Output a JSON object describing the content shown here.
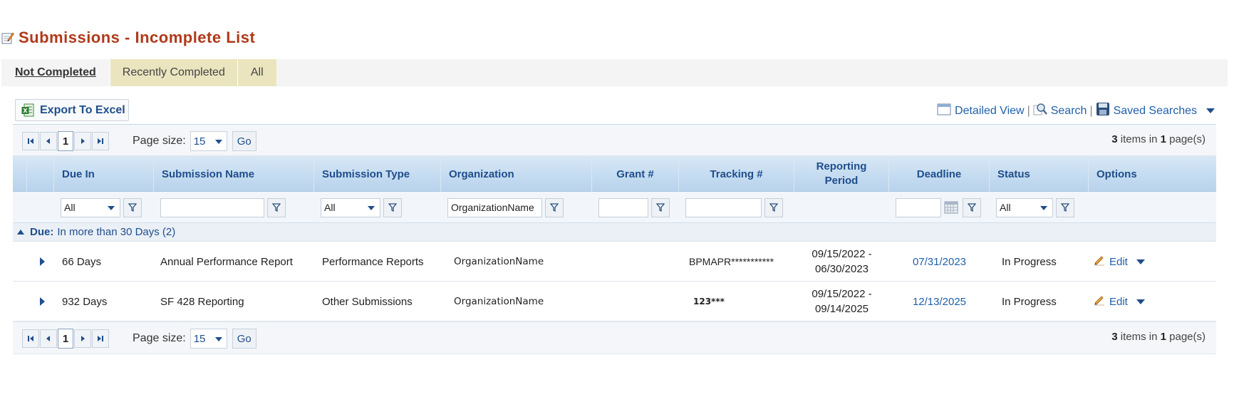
{
  "page": {
    "title": "Submissions - Incomplete List"
  },
  "tabs": [
    {
      "label": "Not Completed",
      "active": true
    },
    {
      "label": "Recently Completed",
      "active": false
    },
    {
      "label": "All",
      "active": false
    }
  ],
  "toolbar": {
    "export_label": "Export To Excel",
    "detailed_view_label": "Detailed View",
    "search_label": "Search",
    "saved_searches_label": "Saved Searches",
    "separator": "|"
  },
  "pager": {
    "current_page": "1",
    "page_size_label": "Page size:",
    "page_size_value": "15",
    "go_label": "Go",
    "items_count": "3",
    "items_text": "items in",
    "pages_count": "1",
    "pages_text": "page(s)"
  },
  "columns": {
    "due_in": "Due In",
    "submission_name": "Submission Name",
    "submission_type": "Submission Type",
    "organization": "Organization",
    "grant": "Grant #",
    "tracking": "Tracking #",
    "reporting_period_1": "Reporting",
    "reporting_period_2": "Period",
    "deadline": "Deadline",
    "status": "Status",
    "options": "Options"
  },
  "filters": {
    "due_in": "All",
    "submission_name": "",
    "submission_type": "All",
    "organization": "OrganizationName",
    "grant": "",
    "tracking": "",
    "deadline": "",
    "status": "All"
  },
  "group": {
    "label": "Due:",
    "value": "In more than 30 Days (2)"
  },
  "rows": [
    {
      "due_in": "66 Days",
      "submission_name": "Annual Performance Report",
      "submission_type": "Performance Reports",
      "organization": "OrganizationName",
      "grant": "",
      "tracking": "BPMAPR***********",
      "period_start": "09/15/2022 -",
      "period_end": "06/30/2023",
      "deadline": "07/31/2023",
      "status": "In Progress",
      "action": "Edit"
    },
    {
      "due_in": "932 Days",
      "submission_name": "SF 428 Reporting",
      "submission_type": "Other Submissions",
      "organization": "OrganizationName",
      "grant": "",
      "tracking": "123***",
      "period_start": "09/15/2022 -",
      "period_end": "09/14/2025",
      "deadline": "12/13/2025",
      "status": "In Progress",
      "action": "Edit"
    }
  ],
  "colors": {
    "title": "#b0391a",
    "link": "#1f5faa",
    "header_text": "#1f4e8c",
    "tab_inactive": "#ebe5bf"
  }
}
